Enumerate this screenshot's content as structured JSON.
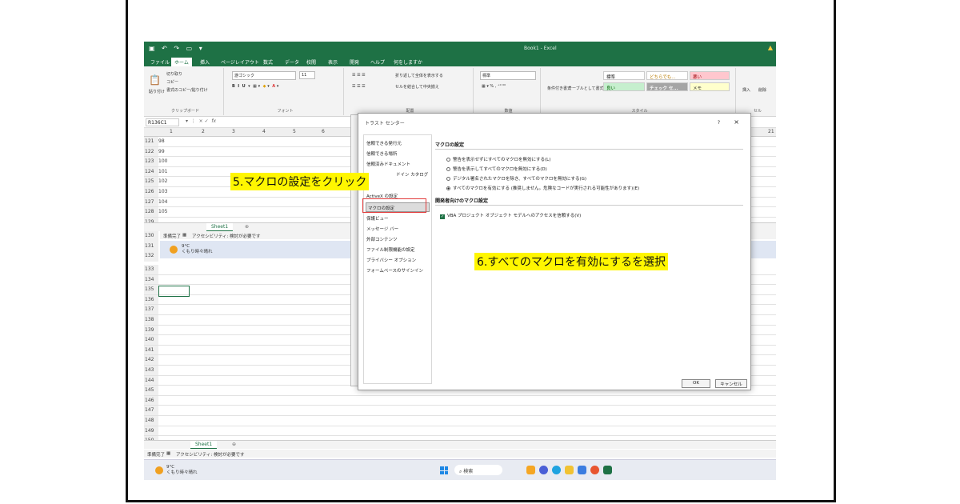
{
  "excel": {
    "title": "Book1 - Excel",
    "menus": [
      "ファイル",
      "ホーム",
      "挿入",
      "ページレイアウト",
      "数式",
      "データ",
      "校閲",
      "表示",
      "開発",
      "ヘルプ",
      "何をしますか"
    ],
    "ribbon": {
      "clipboard": {
        "cut": "切り取り",
        "copy": "コピー",
        "paste": "貼り付け",
        "format_painter": "書式のコピー/貼り付け",
        "label": "クリップボード"
      },
      "font": {
        "name": "游ゴシック",
        "size": "11",
        "label": "フォント"
      },
      "alignment": {
        "wrap": "折り返して全体を表示する",
        "merge": "セルを結合して中央揃え",
        "label": "配置"
      },
      "number": {
        "format": "標準",
        "label": "数値"
      },
      "styles": {
        "conditional": "条件付き書式",
        "table": "テーブルとして書式設定",
        "cells": [
          "標準",
          "どちらでも...",
          "悪い",
          "良い",
          "チェック セ...",
          "メモ"
        ],
        "label": "スタイル"
      },
      "cells": {
        "insert": "挿入",
        "delete": "削除",
        "label": "セル"
      }
    },
    "name_box": "R136C1",
    "columns": [
      "1",
      "2",
      "3",
      "4",
      "5",
      "6"
    ],
    "column_right": "21",
    "upper_rows": [
      {
        "num": "121",
        "val": "98"
      },
      {
        "num": "122",
        "val": "99"
      },
      {
        "num": "123",
        "val": "100"
      },
      {
        "num": "124",
        "val": "101"
      },
      {
        "num": "125",
        "val": "102"
      },
      {
        "num": "126",
        "val": "103"
      },
      {
        "num": "127",
        "val": "104"
      },
      {
        "num": "128",
        "val": "105"
      },
      {
        "num": "129",
        "val": ""
      }
    ],
    "lower_rows": [
      "133",
      "134",
      "135",
      "136",
      "137",
      "138",
      "139",
      "140",
      "141",
      "142",
      "143",
      "144",
      "145",
      "146",
      "147",
      "148",
      "149",
      "150"
    ],
    "inner_rows": [
      "130",
      "131",
      "132"
    ],
    "sheet_tab": "Sheet1",
    "status": {
      "ready": "準備完了",
      "accessibility": "アクセシビリティ: 検討が必要です"
    },
    "weather": {
      "temp": "9°C",
      "desc": "くもり時々晴れ"
    },
    "taskbar_search": "検索"
  },
  "dialog": {
    "title": "トラスト センター",
    "help": "?",
    "close": "×",
    "nav": [
      "信頼できる発行元",
      "信頼できる場所",
      "信頼済みドキュメント",
      "信頼できるアドイン カタログ",
      "アドイン",
      "ActiveX の設定",
      "マクロの設定",
      "保護ビュー",
      "メッセージ バー",
      "外部コンテンツ",
      "ファイル制限機能の設定",
      "プライバシー オプション",
      "フォームベースのサインイン"
    ],
    "nav_visible": [
      "信頼できる発行元",
      "信頼できる場所",
      "信頼済みドキュメント",
      "ドイン カタログ",
      "ActiveX の設定",
      "マクロの設定",
      "保護ビュー",
      "メッセージ バー",
      "外部コンテンツ",
      "ファイル制限機能の設定",
      "プライバシー オプション",
      "フォームベースのサインイン"
    ],
    "section1": "マクロの設定",
    "options": [
      "警告を表示せずにすべてのマクロを無効にする(L)",
      "警告を表示してすべてのマクロを無効にする(D)",
      "デジタル署名されたマクロを除き、すべてのマクロを無効にする(G)",
      "すべてのマクロを有効にする (推奨しません。危険なコードが実行される可能性があります)(E)"
    ],
    "selected_option": 3,
    "section2": "開発者向けのマクロ設定",
    "checkbox": "VBA プロジェクト オブジェクト モデルへのアクセスを信頼する(V)",
    "ok": "OK",
    "cancel": "キャンセル"
  },
  "annotations": {
    "step5": "5.マクロの設定をクリック",
    "step6": "6.すべてのマクロを有効にするを選択"
  },
  "colors": {
    "excel_green": "#1e7145",
    "highlight": "#fff600",
    "red_box": "#e23c3c"
  }
}
